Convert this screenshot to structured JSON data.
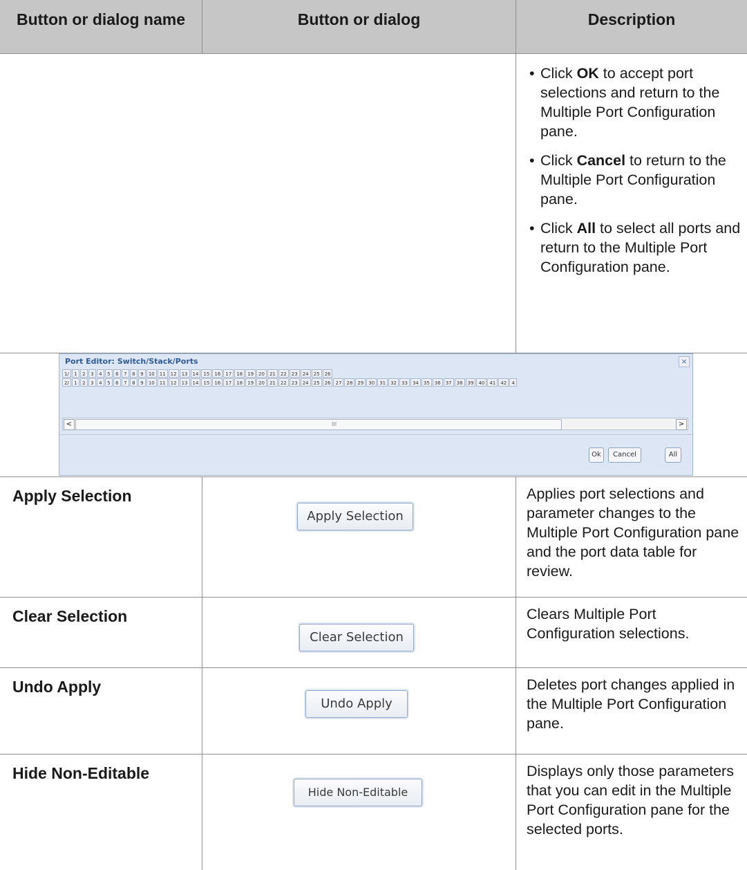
{
  "header": {
    "col1": "Button or dialog name",
    "col2": "Button or dialog",
    "col3": "Description"
  },
  "continuation": {
    "bullets": [
      {
        "pre": "Click ",
        "bold": "OK",
        "post": " to accept port selections and return to the Multiple Port Configuration pane."
      },
      {
        "pre": "Click ",
        "bold": "Cancel",
        "post": " to return to the Multiple Port Configuration pane."
      },
      {
        "pre": "Click ",
        "bold": "All",
        "post": " to select all ports and return to the Multiple Port Configuration pane."
      }
    ]
  },
  "port_editor": {
    "title": "Port Editor: Switch/Stack/Ports",
    "close_glyph": "×",
    "row1_label": "1/",
    "row1_ports": [
      "1",
      "2",
      "3",
      "4",
      "5",
      "6",
      "7",
      "8",
      "9",
      "10",
      "11",
      "12",
      "13",
      "14",
      "15",
      "16",
      "17",
      "18",
      "19",
      "20",
      "21",
      "22",
      "23",
      "24",
      "25",
      "26"
    ],
    "row2_label": "2/",
    "row2_ports": [
      "1",
      "2",
      "3",
      "4",
      "5",
      "6",
      "7",
      "8",
      "9",
      "10",
      "11",
      "12",
      "13",
      "14",
      "15",
      "16",
      "17",
      "18",
      "19",
      "20",
      "21",
      "22",
      "23",
      "24",
      "25",
      "26",
      "27",
      "28",
      "29",
      "30",
      "31",
      "32",
      "33",
      "34",
      "35",
      "36",
      "37",
      "38",
      "39",
      "40",
      "41",
      "42",
      "4"
    ],
    "scroll_left": "<",
    "scroll_right": ">",
    "scroll_grip": "III",
    "ok_label": "Ok",
    "cancel_label": "Cancel",
    "all_label": "All"
  },
  "rows": [
    {
      "name": "Apply Selection",
      "button": "Apply Selection",
      "description": "Applies port selections and parameter changes to the Multiple Port Configuration pane and the port data table for review."
    },
    {
      "name": "Clear Selection",
      "button": "Clear Selection",
      "description": "Clears Multiple Port Configuration selections."
    },
    {
      "name": "Undo Apply",
      "button": "Undo Apply",
      "description": "Deletes port changes applied in the Multiple Port Configuration pane."
    },
    {
      "name": "Hide Non-Editable",
      "button": "Hide Non-Editable",
      "description": "Displays only those parameters that you can edit in the Multiple Port Configuration pane for the selected ports."
    }
  ]
}
